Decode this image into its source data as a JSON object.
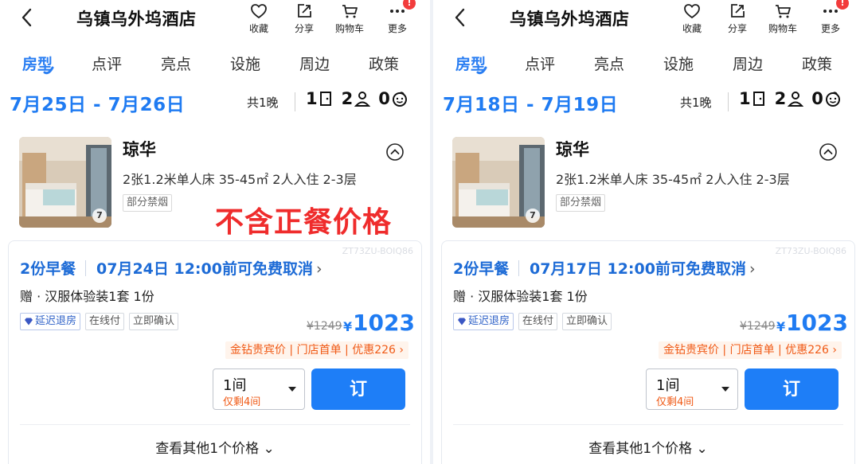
{
  "overlay_text": "不含正餐价格",
  "panels": [
    {
      "hotel_name": "乌镇乌外坞酒店",
      "actions": {
        "favorite": "收藏",
        "share": "分享",
        "cart": "购物车",
        "more": "更多"
      },
      "badge": "!",
      "tabs": [
        "房型",
        "点评",
        "亮点",
        "设施",
        "周边",
        "政策"
      ],
      "date_range": "7月25日 - 7月26日",
      "nights": "共1晚",
      "rooms": "1",
      "adults": "2",
      "children": "0",
      "room": {
        "title": "琼华",
        "info": "2张1.2米单人床  35-45㎡  2人入住  2-3层",
        "tag": "部分禁烟",
        "image_count": "7"
      },
      "rate": {
        "watermark": "ZT73ZU-BOIQ86",
        "breakfast": "2份早餐",
        "cancel": "07月24日 12:00前可免费取消",
        "gift": "赠 · 汉服体验装1套 1份",
        "chips": [
          "延迟退房",
          "在线付",
          "立即确认"
        ],
        "orig_price": "¥1249",
        "currency": "¥",
        "price": "1023",
        "promo": "金钻贵宾价 | 门店首单 | 优惠226 ›",
        "qty": "1间",
        "qty_left": "仅剩4间",
        "book": "订",
        "more_prices": "查看其他1个价格"
      }
    },
    {
      "hotel_name": "乌镇乌外坞酒店",
      "actions": {
        "favorite": "收藏",
        "share": "分享",
        "cart": "购物车",
        "more": "更多"
      },
      "badge": "!",
      "tabs": [
        "房型",
        "点评",
        "亮点",
        "设施",
        "周边",
        "政策"
      ],
      "date_range": "7月18日 - 7月19日",
      "nights": "共1晚",
      "rooms": "1",
      "adults": "2",
      "children": "0",
      "room": {
        "title": "琼华",
        "info": "2张1.2米单人床  35-45㎡  2人入住  2-3层",
        "tag": "部分禁烟",
        "image_count": "7"
      },
      "rate": {
        "watermark": "ZT73ZU-BOIQ86",
        "breakfast": "2份早餐",
        "cancel": "07月17日 12:00前可免费取消",
        "gift": "赠 · 汉服体验装1套 1份",
        "chips": [
          "延迟退房",
          "在线付",
          "立即确认"
        ],
        "orig_price": "¥1249",
        "currency": "¥",
        "price": "1023",
        "promo": "金钻贵宾价 | 门店首单 | 优惠226 ›",
        "qty": "1间",
        "qty_left": "仅剩4间",
        "book": "订",
        "more_prices": "查看其他1个价格"
      }
    }
  ],
  "colors": {
    "accent": "#1f7bf2",
    "overlay": "#ef2c2c",
    "promo": "#f05a16"
  },
  "icons": [
    "back-icon",
    "heart-icon",
    "share-icon",
    "cart-icon",
    "more-icon",
    "door-icon",
    "person-icon",
    "child-icon",
    "chevron-up-icon",
    "diamond-icon",
    "chevron-right-icon",
    "chevron-down-icon"
  ]
}
